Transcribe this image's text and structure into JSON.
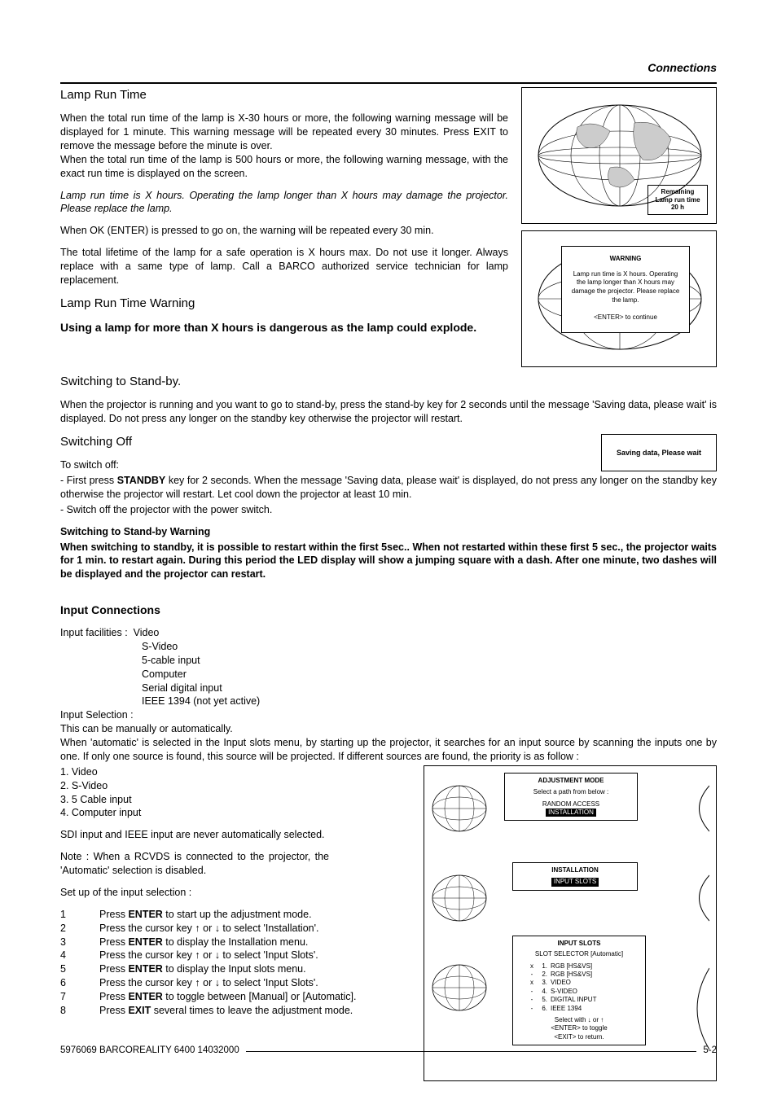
{
  "header": {
    "title": "Connections"
  },
  "sections": {
    "lamp_run_time": {
      "heading": "Lamp Run Time",
      "p1": "When the total run time of the lamp is X-30 hours or more, the following warning message will be displayed for 1 minute.  This warning message will be repeated every 30 minutes. Press EXIT to remove the message before the minute is over.",
      "p2": "When the total run time of the lamp is 500 hours or more, the following warning message, with the exact run time is displayed on the screen.",
      "p3_italic": "Lamp run time is X hours.  Operating the lamp longer than X hours may damage the projector.  Please replace the lamp.",
      "p4": "When OK (ENTER) is pressed to go on, the warning will be repeated every 30 min.",
      "p5": "The total lifetime of the lamp for a safe operation is X hours max. Do not use it longer.  Always replace with a same type of lamp.  Call a BARCO authorized service technician for lamp replacement."
    },
    "lamp_warning": {
      "heading": "Lamp Run Time Warning",
      "bold_line": "Using a lamp for more than X hours is dangerous as the lamp could explode."
    },
    "standby": {
      "heading": "Switching to Stand-by.",
      "p1": "When the projector is running and you want to go to stand-by, press the stand-by key for 2 seconds until the message 'Saving data, please wait' is displayed.  Do not press any longer on the standby key otherwise the projector will restart."
    },
    "switch_off": {
      "heading": "Switching Off",
      "intro": "To switch off:",
      "li1a": "- First press ",
      "li1_key": "STANDBY",
      "li1b": " key for 2 seconds.  When the message 'Saving data, please wait' is displayed, do not press any longer on the standby key otherwise the projector will restart. Let cool down the projector at least 10 min.",
      "li2": "- Switch off the projector with the power switch.",
      "warn_h": "Switching to Stand-by Warning",
      "warn_p": "When switching to standby, it is possible to restart within the first 5sec..  When not restarted within these first 5 sec., the projector waits for 1 min. to restart again.  During this period the LED display will show a jumping square with a dash.  After one minute, two dashes will be displayed and the projector can restart."
    },
    "input": {
      "heading": "Input Connections",
      "facilities_label": "Input facilities :",
      "facilities": [
        "Video",
        "S-Video",
        "5-cable input",
        "Computer",
        "Serial digital input",
        "IEEE 1394 (not yet active)"
      ],
      "selection_label": "Input Selection :",
      "p_sel_1": "This can be manually or automatically.",
      "p_sel_2": "When 'automatic' is selected in the Input slots menu, by starting up the projector, it searches for an input source by scanning the inputs one by one.  If only one source is found, this source will be projected.  If different sources are found, the priority is as follow :",
      "order": [
        "1. Video",
        "2. S-Video",
        "3. 5 Cable input",
        "4. Computer input"
      ],
      "p_sel_3": "SDI input and IEEE input are never automatically selected.",
      "p_sel_4": "Note : When a RCVDS is connected to the projector, the 'Automatic' selection is disabled.",
      "p_sel_5": "Set up of the input selection :",
      "steps": [
        {
          "n": "1",
          "a": "Press ",
          "k": "ENTER",
          "b": " to start up the adjustment mode."
        },
        {
          "n": "2",
          "a": "Press the cursor key ↑ or ↓  to select 'Installation'.",
          "k": "",
          "b": ""
        },
        {
          "n": "3",
          "a": "Press ",
          "k": "ENTER",
          "b": " to display the Installation menu."
        },
        {
          "n": "4",
          "a": "Press the cursor key ↑ or ↓  to select 'Input Slots'.",
          "k": "",
          "b": ""
        },
        {
          "n": "5",
          "a": "Press ",
          "k": "ENTER",
          "b": " to display the Input slots menu."
        },
        {
          "n": "6",
          "a": "Press the cursor key ↑ or ↓  to select 'Input Slots'.",
          "k": "",
          "b": ""
        },
        {
          "n": "7",
          "a": "Press ",
          "k": "ENTER",
          "b": " to toggle between [Manual] or [Automatic]."
        },
        {
          "n": "8",
          "a": "Press ",
          "k": "EXIT",
          "b": " several times to leave the adjustment mode."
        }
      ]
    }
  },
  "side_figures": {
    "remaining_box": {
      "l1": "Remaining",
      "l2": "Lamp run time",
      "l3": "20 h"
    },
    "warn_box": {
      "title": "WARNING",
      "body": "Lamp run time is X hours. Operating the lamp longer than X hours may damage the projector. Please replace the lamp.",
      "cont": "<ENTER> to continue"
    },
    "saving": "Saving data, Please wait"
  },
  "menus": {
    "adj": {
      "title": "ADJUSTMENT MODE",
      "sub": "Select a path from below :",
      "i1": "RANDOM ACCESS",
      "i2": "INSTALLATION"
    },
    "inst": {
      "title": "INSTALLATION",
      "i1": "INPUT SLOTS"
    },
    "slots": {
      "title": "INPUT SLOTS",
      "sub": "SLOT SELECTOR [Automatic]",
      "rows": [
        [
          "x",
          "1.",
          "RGB [HS&VS]"
        ],
        [
          "-",
          "2.",
          "RGB [HS&VS]"
        ],
        [
          "x",
          "3.",
          "VIDEO"
        ],
        [
          "-",
          "4.",
          "S-VIDEO"
        ],
        [
          "-",
          "5.",
          "DIGITAL INPUT"
        ],
        [
          "-",
          "6.",
          "IEEE 1394"
        ]
      ],
      "f1": "Select with  ↓  or ↑",
      "f2": "<ENTER> to toggle",
      "f3": "<EXIT> to return."
    }
  },
  "footer": {
    "left": "5976069 BARCOREALITY 6400 14032000",
    "right": "5-2"
  }
}
